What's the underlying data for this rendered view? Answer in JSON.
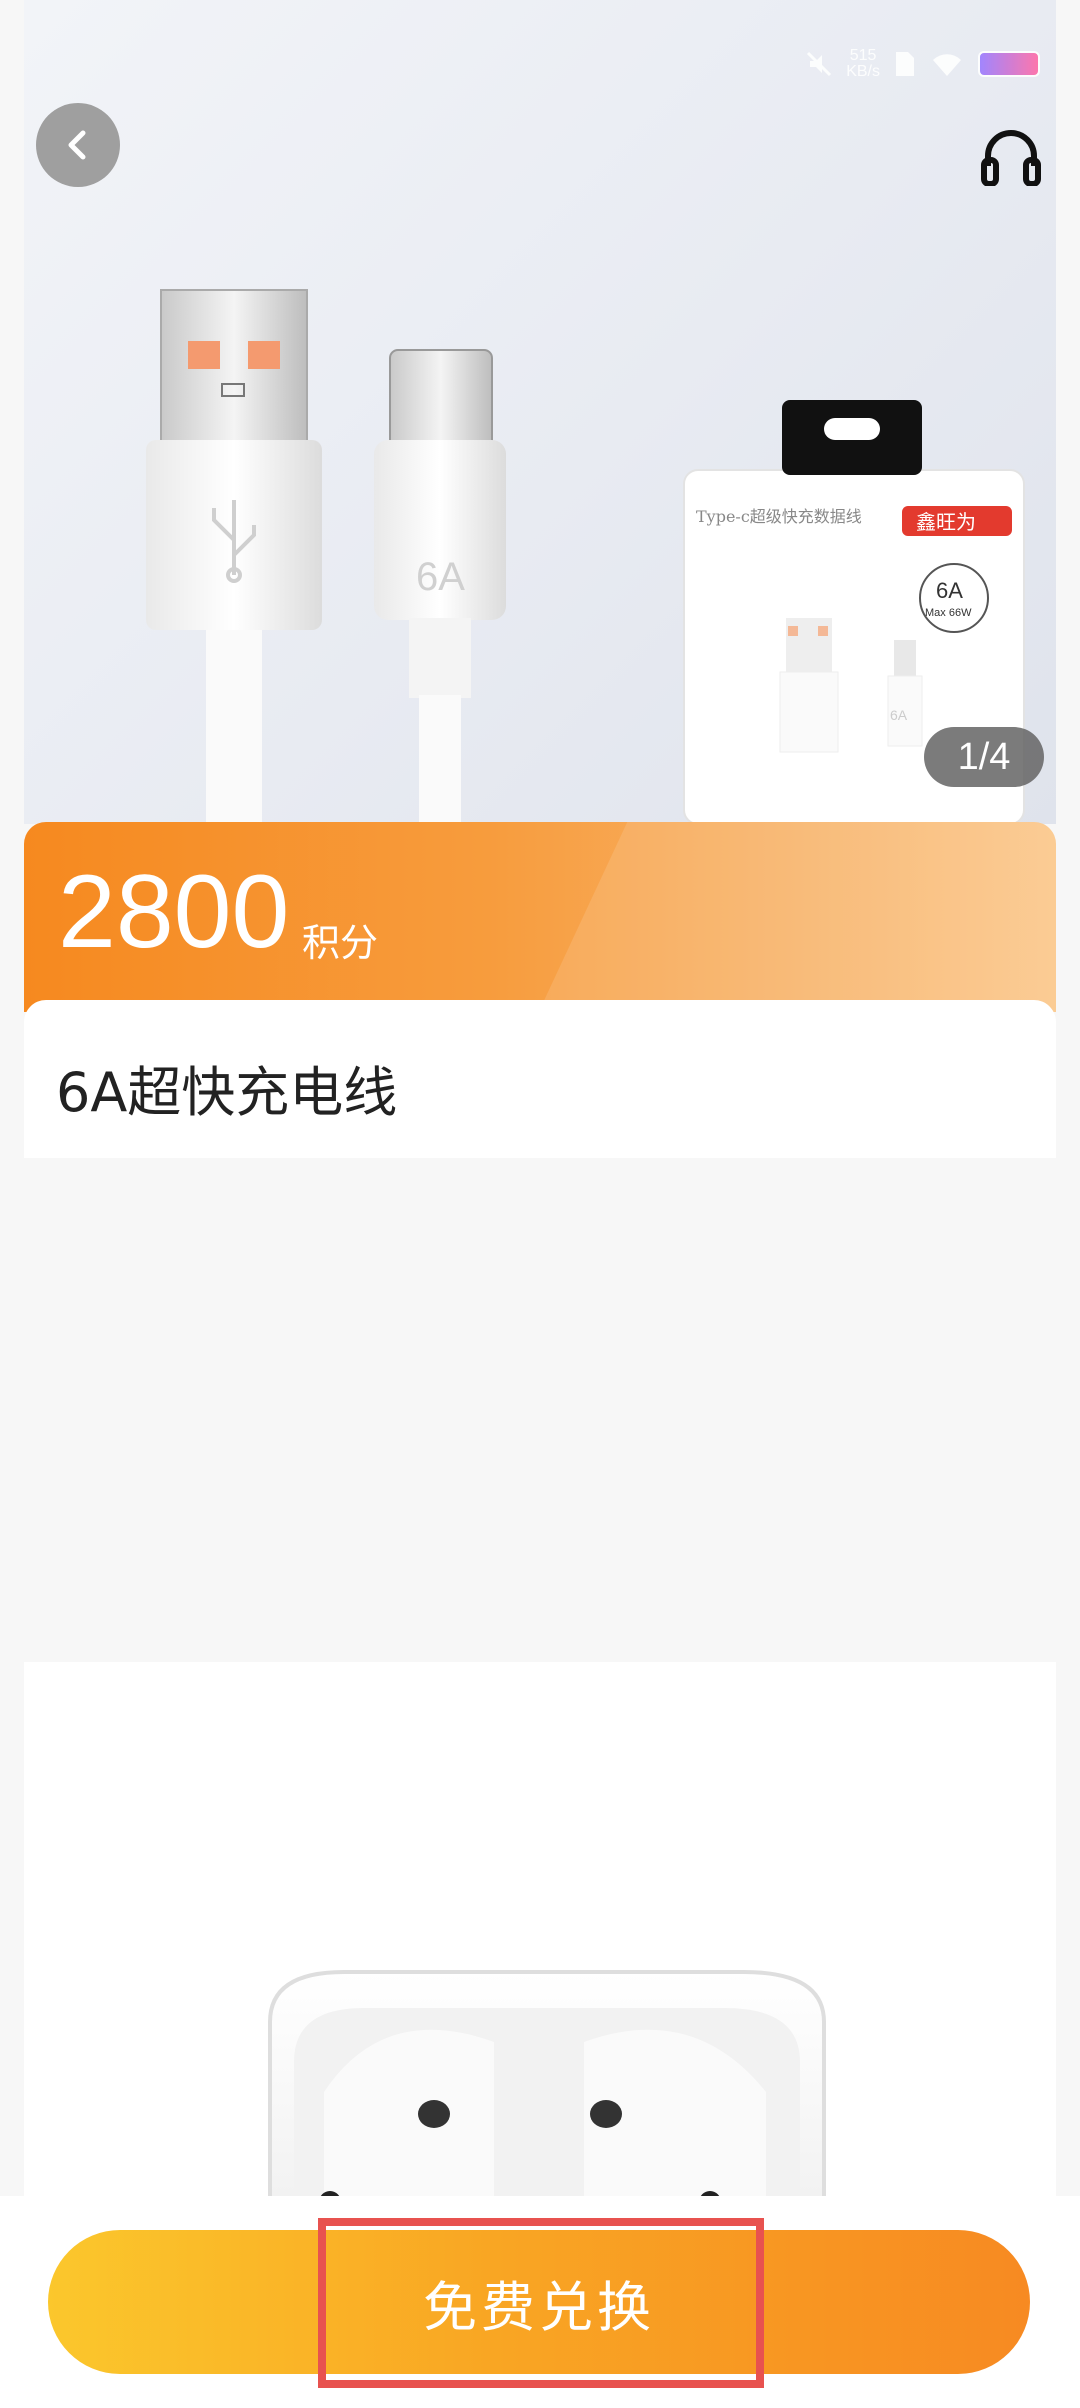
{
  "status_bar": {
    "net_speed": "515",
    "net_unit": "KB/s"
  },
  "product": {
    "image_label_6a": "6A",
    "package_title": "Type-c超级快充数据线",
    "package_brand": "鑫旺为",
    "package_spec": "6A",
    "package_max": "Max 66W",
    "gallery_index": "1/4",
    "price_points": "2800",
    "price_unit": "积分",
    "name": "6A超快充电线"
  },
  "actions": {
    "redeem_label": "免费兑换"
  },
  "colors": {
    "accent_orange": "#f78a22",
    "accent_yellow": "#fbc72c",
    "highlight_red": "#e8524f"
  }
}
